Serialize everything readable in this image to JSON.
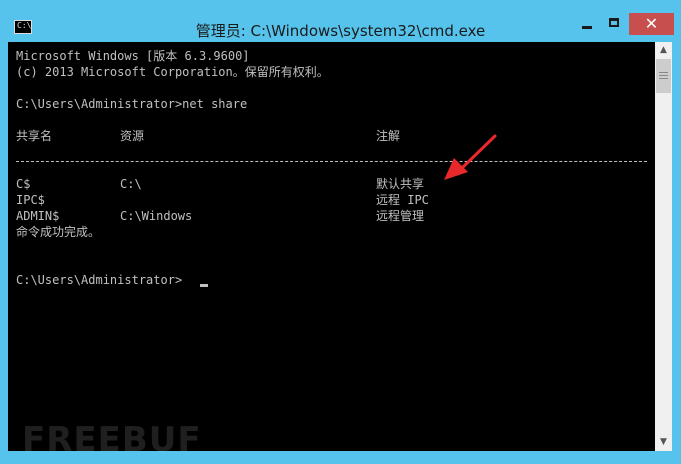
{
  "window": {
    "title": "管理员: C:\\Windows\\system32\\cmd.exe",
    "app_icon_glyph": "C:\\",
    "controls": {
      "minimize": "minimize-icon",
      "maximize": "maximize-icon",
      "close": "✕"
    }
  },
  "console": {
    "header_line1": "Microsoft Windows [版本 6.3.9600]",
    "header_line2": "(c) 2013 Microsoft Corporation。保留所有权利。",
    "command_line": "C:\\Users\\Administrator>net share",
    "columns": {
      "share_name": "共享名",
      "resource": "资源",
      "remark": "注解"
    },
    "shares": [
      {
        "name": "C$",
        "resource": "C:\\",
        "remark": "默认共享"
      },
      {
        "name": "IPC$",
        "resource": "",
        "remark": "远程 IPC"
      },
      {
        "name": "ADMIN$",
        "resource": "C:\\Windows",
        "remark": "远程管理"
      }
    ],
    "success_message": "命令成功完成。",
    "prompt": "C:\\Users\\Administrator>"
  },
  "colors": {
    "console_bg": "#000000",
    "console_text": "#c0c0c0",
    "frame": "#55c3ec",
    "close": "#c7504f",
    "annotation": "#e8282b"
  },
  "watermark": "FREEBUF"
}
